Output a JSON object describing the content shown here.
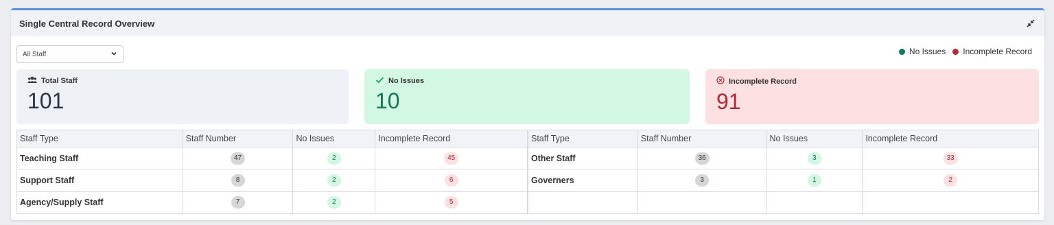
{
  "panel": {
    "title": "Single Central Record Overview"
  },
  "filter": {
    "selected": "All Staff"
  },
  "legend": [
    {
      "label": "No Issues",
      "color": "#11765a"
    },
    {
      "label": "Incomplete Record",
      "color": "#b02a37"
    }
  ],
  "stats": {
    "total": {
      "label": "Total Staff",
      "value": "101",
      "icon": "users-icon"
    },
    "no_issues": {
      "label": "No Issues",
      "value": "10",
      "icon": "check-icon"
    },
    "incomplete": {
      "label": "Incomplete Record",
      "value": "91",
      "icon": "x-circle-icon"
    }
  },
  "table_left": {
    "headers": [
      "Staff Type",
      "Staff Number",
      "No Issues",
      "Incomplete Record"
    ],
    "rows": [
      {
        "type": "Teaching Staff",
        "number": "47",
        "no_issues": "2",
        "incomplete": "45"
      },
      {
        "type": "Support Staff",
        "number": "8",
        "no_issues": "2",
        "incomplete": "6"
      },
      {
        "type": "Agency/Supply Staff",
        "number": "7",
        "no_issues": "2",
        "incomplete": "5"
      }
    ]
  },
  "table_right": {
    "headers": [
      "Staff Type",
      "Staff Number",
      "No Issues",
      "Incomplete Record"
    ],
    "rows": [
      {
        "type": "Other Staff",
        "number": "36",
        "no_issues": "3",
        "incomplete": "33"
      },
      {
        "type": "Governers",
        "number": "3",
        "no_issues": "1",
        "incomplete": "2"
      }
    ]
  }
}
